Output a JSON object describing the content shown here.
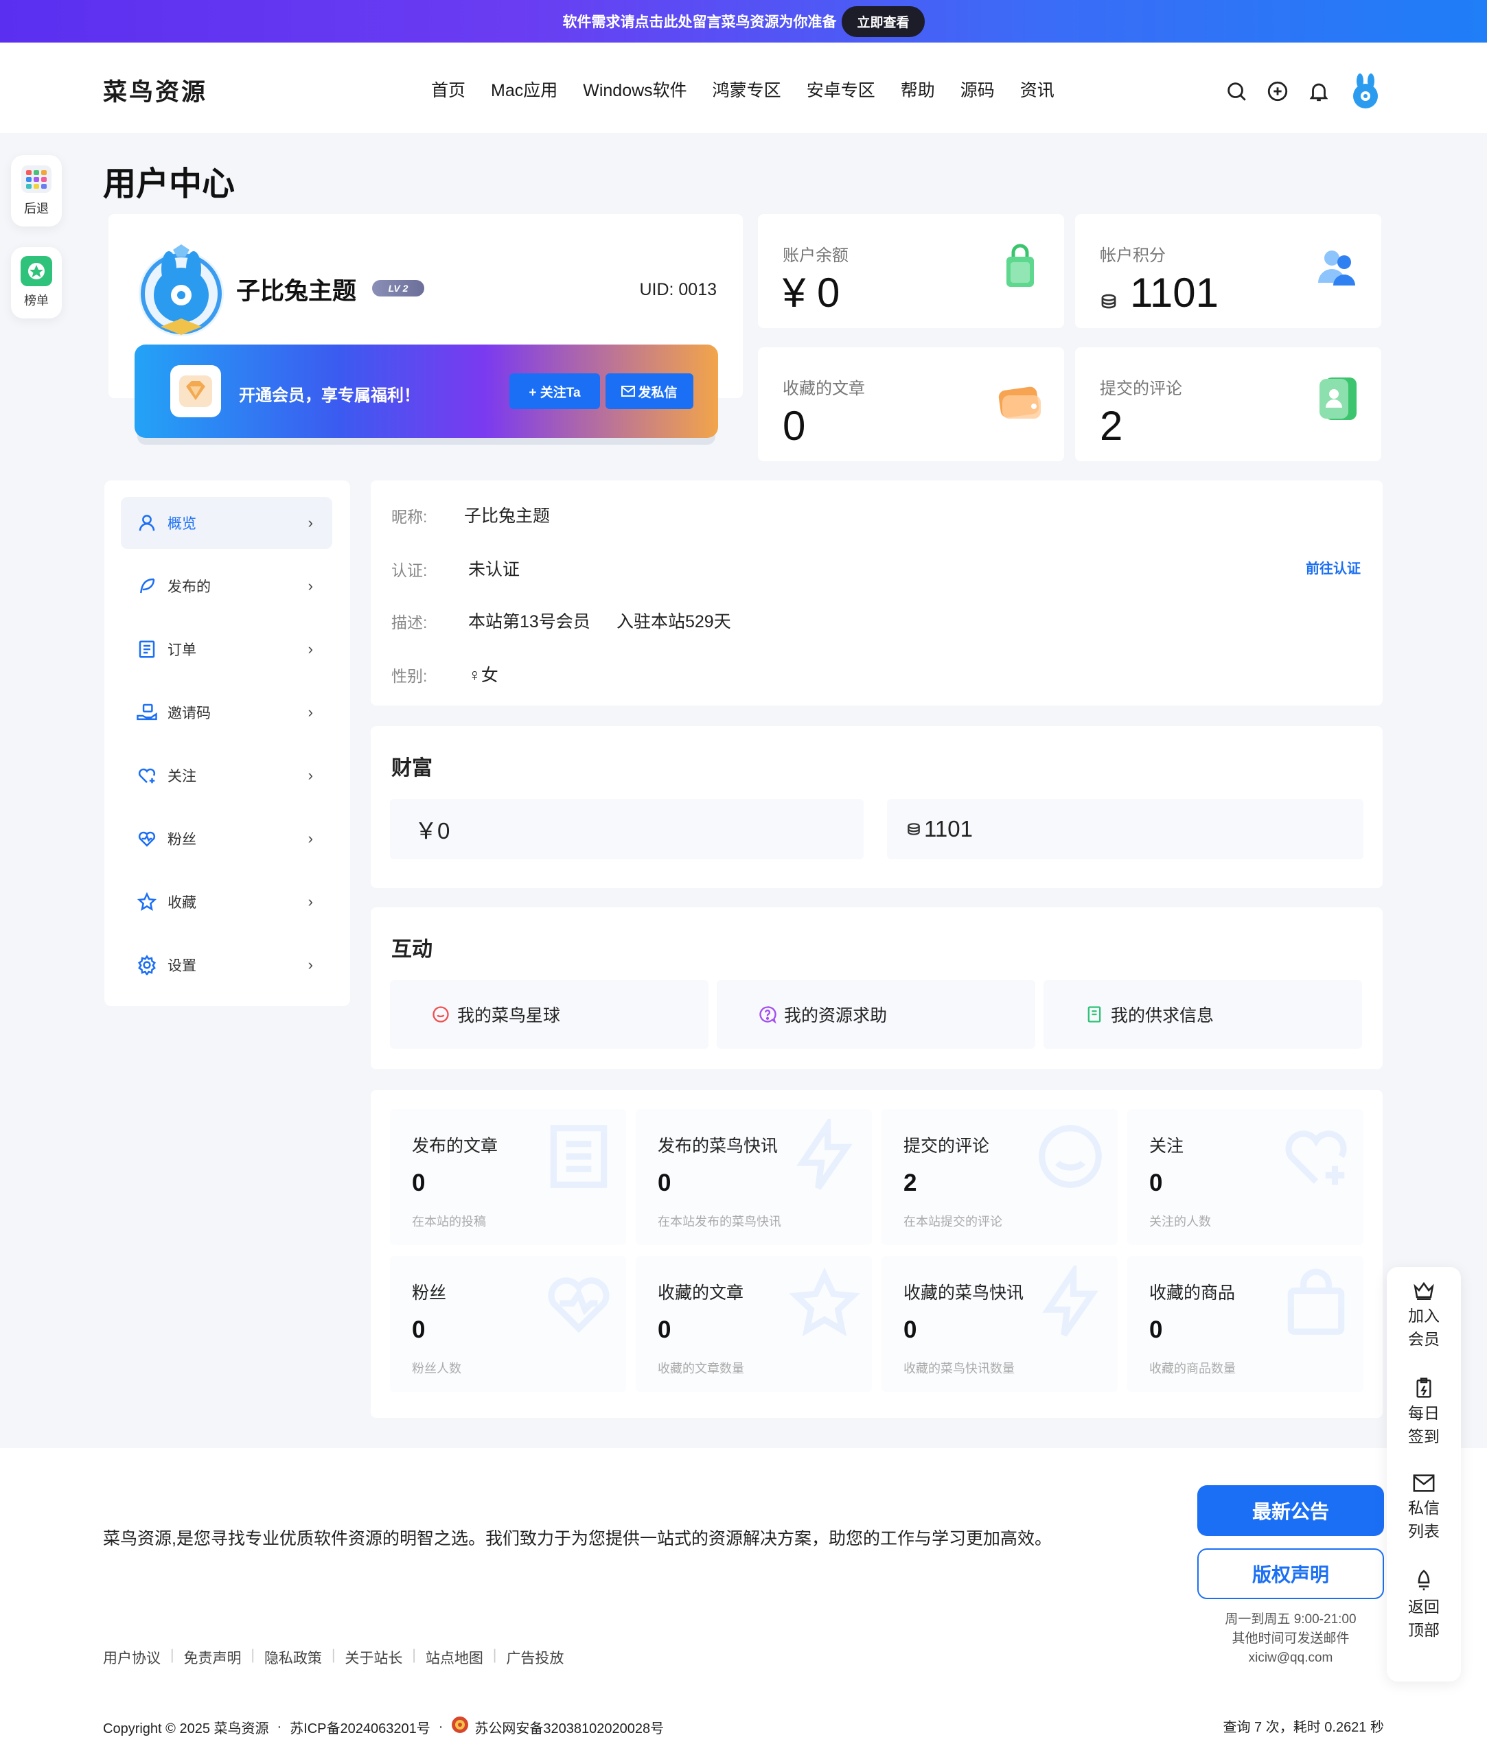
{
  "banner": {
    "text": "软件需求请点击此处留言菜鸟资源为你准备",
    "button": "立即查看"
  },
  "header": {
    "logo": "菜鸟资源",
    "nav": [
      "首页",
      "Mac应用",
      "Windows软件",
      "鸿蒙专区",
      "安卓专区",
      "帮助",
      "源码",
      "资讯"
    ]
  },
  "leftfloat": {
    "back": "后退",
    "rank": "榜单"
  },
  "page_title": "用户中心",
  "profile": {
    "name": "子比兔主题",
    "level": "LV 2",
    "uid": "UID: 0013"
  },
  "vip": {
    "text": "开通会员，享专属福利！",
    "follow": "+ 关注Ta",
    "message": "发私信"
  },
  "stats": {
    "balance": {
      "label": "账户余额",
      "value": "¥ 0"
    },
    "points": {
      "label": "帐户积分",
      "value": "1101"
    },
    "fav_articles": {
      "label": "收藏的文章",
      "value": "0"
    },
    "comments": {
      "label": "提交的评论",
      "value": "2"
    }
  },
  "menu": [
    "概览",
    "发布的",
    "订单",
    "邀请码",
    "关注",
    "粉丝",
    "收藏",
    "设置"
  ],
  "info": {
    "nick_label": "昵称:",
    "nick": "子比兔主题",
    "verify_label": "认证:",
    "verify": "未认证",
    "verify_link": "前往认证",
    "desc_label": "描述:",
    "desc1": "本站第13号会员",
    "desc2": "入驻本站529天",
    "gender_label": "性别:",
    "gender": "♀女"
  },
  "wealth": {
    "title": "财富",
    "money": "￥0",
    "points": "1101"
  },
  "interact": {
    "title": "互动",
    "items": [
      "我的菜鸟星球",
      "我的资源求助",
      "我的供求信息"
    ]
  },
  "grid": [
    {
      "t": "发布的文章",
      "n": "0",
      "d": "在本站的投稿"
    },
    {
      "t": "发布的菜鸟快讯",
      "n": "0",
      "d": "在本站发布的菜鸟快讯"
    },
    {
      "t": "提交的评论",
      "n": "2",
      "d": "在本站提交的评论"
    },
    {
      "t": "关注",
      "n": "0",
      "d": "关注的人数"
    },
    {
      "t": "粉丝",
      "n": "0",
      "d": "粉丝人数"
    },
    {
      "t": "收藏的文章",
      "n": "0",
      "d": "收藏的文章数量"
    },
    {
      "t": "收藏的菜鸟快讯",
      "n": "0",
      "d": "收藏的菜鸟快讯数量"
    },
    {
      "t": "收藏的商品",
      "n": "0",
      "d": "收藏的商品数量"
    }
  ],
  "footer": {
    "text": "菜鸟资源,是您寻找专业优质软件资源的明智之选。我们致力于为您提供一站式的资源解决方案，助您的工作与学习更加高效。",
    "notice": "最新公告",
    "copyright": "版权声明",
    "hours1": "周一到周五 9:00-21:00",
    "hours2": "其他时间可发送邮件",
    "email": "xiciw@qq.com",
    "links": [
      "用户协议",
      "免责声明",
      "隐私政策",
      "关于站长",
      "站点地图",
      "广告投放"
    ],
    "copy": "Copyright © 2025 菜鸟资源",
    "icp": "苏ICP备2024063201号",
    "police": "苏公网安备32038102020028号",
    "query": "查询 7 次，耗时 0.2621 秒"
  },
  "rightfloat": [
    {
      "a": "加入",
      "b": "会员"
    },
    {
      "a": "每日",
      "b": "签到"
    },
    {
      "a": "私信",
      "b": "列表"
    },
    {
      "a": "返回",
      "b": "顶部"
    }
  ]
}
